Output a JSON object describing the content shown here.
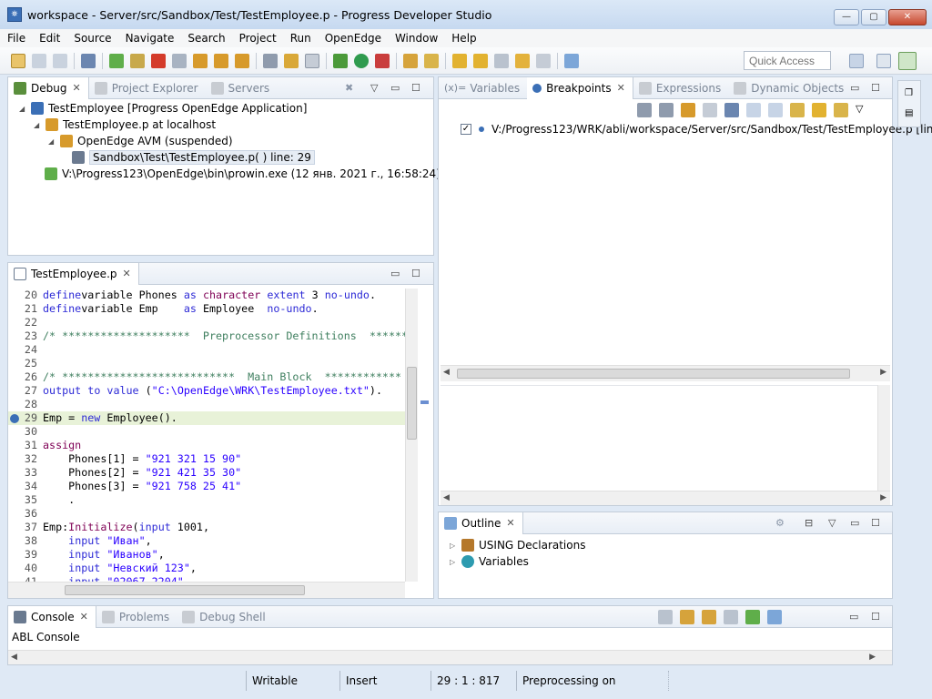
{
  "window": {
    "title": "workspace - Server/src/Sandbox/Test/TestEmployee.p - Progress Developer Studio",
    "app_icon_glyph": "⛯",
    "min_glyph": "—",
    "max_glyph": "▢",
    "close_glyph": "✕"
  },
  "menu": [
    "File",
    "Edit",
    "Source",
    "Navigate",
    "Search",
    "Project",
    "Run",
    "OpenEdge",
    "Window",
    "Help"
  ],
  "quick_access": {
    "placeholder": "Quick Access"
  },
  "debug_panel": {
    "tabs": [
      {
        "label": "Debug",
        "icon": "debug-icon"
      },
      {
        "label": "Project Explorer",
        "icon": "project-explorer-icon"
      },
      {
        "label": "Servers",
        "icon": "servers-icon"
      }
    ],
    "tree": {
      "launch": "TestEmployee [Progress OpenEdge Application]",
      "target": "TestEmployee.p at localhost",
      "avm": "OpenEdge AVM (suspended)",
      "frame": "Sandbox\\Test\\TestEmployee.p(  ) line: 29",
      "process": "V:\\Progress123\\OpenEdge\\bin\\prowin.exe (12 янв. 2021 г., 16:58:24)"
    }
  },
  "editor": {
    "tab_label": "TestEmployee.p",
    "lines": [
      {
        "n": "20",
        "parts": [
          [
            "kwb",
            "define"
          ],
          [
            "",
            "variable Phones "
          ],
          [
            "kwb",
            "as"
          ],
          [
            "",
            " "
          ],
          [
            "ty",
            "character"
          ],
          [
            "",
            " "
          ],
          [
            "kwb",
            "extent"
          ],
          [
            "",
            " 3 "
          ],
          [
            "kwb",
            "no-undo"
          ],
          [
            "",
            "."
          ]
        ]
      },
      {
        "n": "21",
        "parts": [
          [
            "kwb",
            "define"
          ],
          [
            "",
            "variable Emp    "
          ],
          [
            "kwb",
            "as"
          ],
          [
            "",
            " Employee  "
          ],
          [
            "kwb",
            "no-undo"
          ],
          [
            "",
            "."
          ]
        ]
      },
      {
        "n": "22",
        "parts": []
      },
      {
        "n": "23",
        "parts": [
          [
            "cmt",
            "/* ********************  Preprocessor Definitions  ******"
          ]
        ]
      },
      {
        "n": "24",
        "parts": []
      },
      {
        "n": "25",
        "parts": []
      },
      {
        "n": "26",
        "parts": [
          [
            "cmt",
            "/* ***************************  Main Block  ************"
          ]
        ]
      },
      {
        "n": "27",
        "parts": [
          [
            "kwb",
            "output"
          ],
          [
            "",
            " "
          ],
          [
            "kwb",
            "to"
          ],
          [
            "",
            " "
          ],
          [
            "kwb",
            "value"
          ],
          [
            "",
            " ("
          ],
          [
            "str",
            "\"C:\\OpenEdge\\WRK\\TestEmployee.txt\""
          ],
          [
            "",
            ")."
          ]
        ]
      },
      {
        "n": "28",
        "parts": []
      },
      {
        "n": "29",
        "parts": [
          [
            "",
            "Emp = "
          ],
          [
            "kwb",
            "new"
          ],
          [
            "",
            " Employee()."
          ]
        ],
        "current": true
      },
      {
        "n": "30",
        "parts": []
      },
      {
        "n": "31",
        "parts": [
          [
            "kw",
            "assign"
          ]
        ]
      },
      {
        "n": "32",
        "parts": [
          [
            "",
            "    Phones[1] = "
          ],
          [
            "str",
            "\"921 321 15 90\""
          ]
        ]
      },
      {
        "n": "33",
        "parts": [
          [
            "",
            "    Phones[2] = "
          ],
          [
            "str",
            "\"921 421 35 30\""
          ]
        ]
      },
      {
        "n": "34",
        "parts": [
          [
            "",
            "    Phones[3] = "
          ],
          [
            "str",
            "\"921 758 25 41\""
          ]
        ]
      },
      {
        "n": "35",
        "parts": [
          [
            "",
            "    ."
          ]
        ]
      },
      {
        "n": "36",
        "parts": []
      },
      {
        "n": "37",
        "parts": [
          [
            "",
            "Emp:"
          ],
          [
            "kw",
            "Initialize"
          ],
          [
            "",
            "("
          ],
          [
            "kwb",
            "input"
          ],
          [
            "",
            " 1001,"
          ]
        ]
      },
      {
        "n": "38",
        "parts": [
          [
            "",
            "    "
          ],
          [
            "kwb",
            "input"
          ],
          [
            "",
            " "
          ],
          [
            "str",
            "\"Иван\""
          ],
          [
            "",
            ","
          ]
        ]
      },
      {
        "n": "39",
        "parts": [
          [
            "",
            "    "
          ],
          [
            "kwb",
            "input"
          ],
          [
            "",
            " "
          ],
          [
            "str",
            "\"Иванов\""
          ],
          [
            "",
            ","
          ]
        ]
      },
      {
        "n": "40",
        "parts": [
          [
            "",
            "    "
          ],
          [
            "kwb",
            "input"
          ],
          [
            "",
            " "
          ],
          [
            "str",
            "\"Невский 123\""
          ],
          [
            "",
            ","
          ]
        ]
      },
      {
        "n": "41",
        "parts": [
          [
            "",
            "    "
          ],
          [
            "kwb",
            "input"
          ],
          [
            "",
            " "
          ],
          [
            "str",
            "\"02067 2204\""
          ],
          [
            "",
            ","
          ]
        ]
      }
    ]
  },
  "breakpoints_panel": {
    "tabs": [
      {
        "label": "Variables",
        "icon": "variables-icon",
        "prefix": "(x)="
      },
      {
        "label": "Breakpoints",
        "icon": "breakpoints-icon"
      },
      {
        "label": "Expressions",
        "icon": "expressions-icon"
      },
      {
        "label": "Dynamic Objects",
        "icon": "dynamic-objects-icon"
      }
    ],
    "item": "V:/Progress123/WRK/abli/workspace/Server/src/Sandbox/Test/TestEmployee.p [lin"
  },
  "outline_panel": {
    "tab_label": "Outline",
    "items": [
      "USING Declarations",
      "Variables"
    ]
  },
  "console_panel": {
    "tabs": [
      {
        "label": "Console",
        "icon": "console-icon"
      },
      {
        "label": "Problems",
        "icon": "problems-icon"
      },
      {
        "label": "Debug Shell",
        "icon": "debug-shell-icon"
      }
    ],
    "title": "ABL Console"
  },
  "status": {
    "writable": "Writable",
    "insert": "Insert",
    "position": "29 : 1 : 817",
    "preprocessing": "Preprocessing on"
  },
  "colors": {
    "accent": "#3b6fb6",
    "current_line": "#e8f2d8",
    "keyword": "#2d2ad6",
    "comment": "#3f7f5f"
  }
}
